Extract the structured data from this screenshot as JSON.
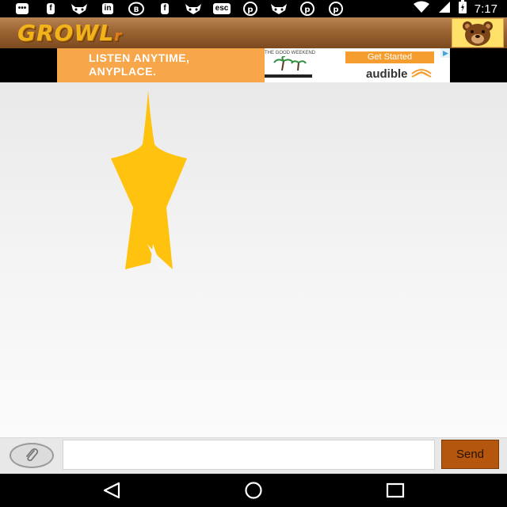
{
  "status_bar": {
    "notification_icons": [
      {
        "name": "chat-icon",
        "glyph": "•••"
      },
      {
        "name": "facebook-icon",
        "glyph": "f"
      },
      {
        "name": "wolf-icon",
        "glyph": "🐺"
      },
      {
        "name": "linkedin-icon",
        "glyph": "in"
      },
      {
        "name": "viber-icon",
        "glyph": "B"
      },
      {
        "name": "facebook-icon",
        "glyph": "f"
      },
      {
        "name": "wolf-icon",
        "glyph": "🐺"
      },
      {
        "name": "esc-icon",
        "glyph": "esc"
      },
      {
        "name": "pinterest-icon",
        "glyph": "P"
      },
      {
        "name": "wolf-icon",
        "glyph": "🐺"
      },
      {
        "name": "pinterest-icon",
        "glyph": "P"
      },
      {
        "name": "pinterest-icon",
        "glyph": "P"
      }
    ],
    "time": "7:17"
  },
  "app_bar": {
    "logo_text": "GROWL",
    "logo_suffix": "r",
    "avatar_icon": "bear-icon"
  },
  "ad": {
    "headline_line1": "LISTEN ANYTIME,",
    "headline_line2": "ANYPLACE.",
    "thumb_text": "THE GOOD WEEKEND",
    "cta_label": "Get Started",
    "brand": "audible",
    "adchoices_icon": "adchoices-icon"
  },
  "content": {
    "graphic_color": "#FFC20E"
  },
  "compose": {
    "attach_icon": "paperclip-icon",
    "input_value": "",
    "input_placeholder": "",
    "send_label": "Send"
  },
  "nav": {
    "back_icon": "back-icon",
    "home_icon": "home-icon",
    "recents_icon": "recents-icon"
  },
  "colors": {
    "app_bar_brown": "#9B6432",
    "logo_yellow": "#F2B21A",
    "send_button": "#B4560D",
    "ad_orange": "#F7A64A"
  }
}
